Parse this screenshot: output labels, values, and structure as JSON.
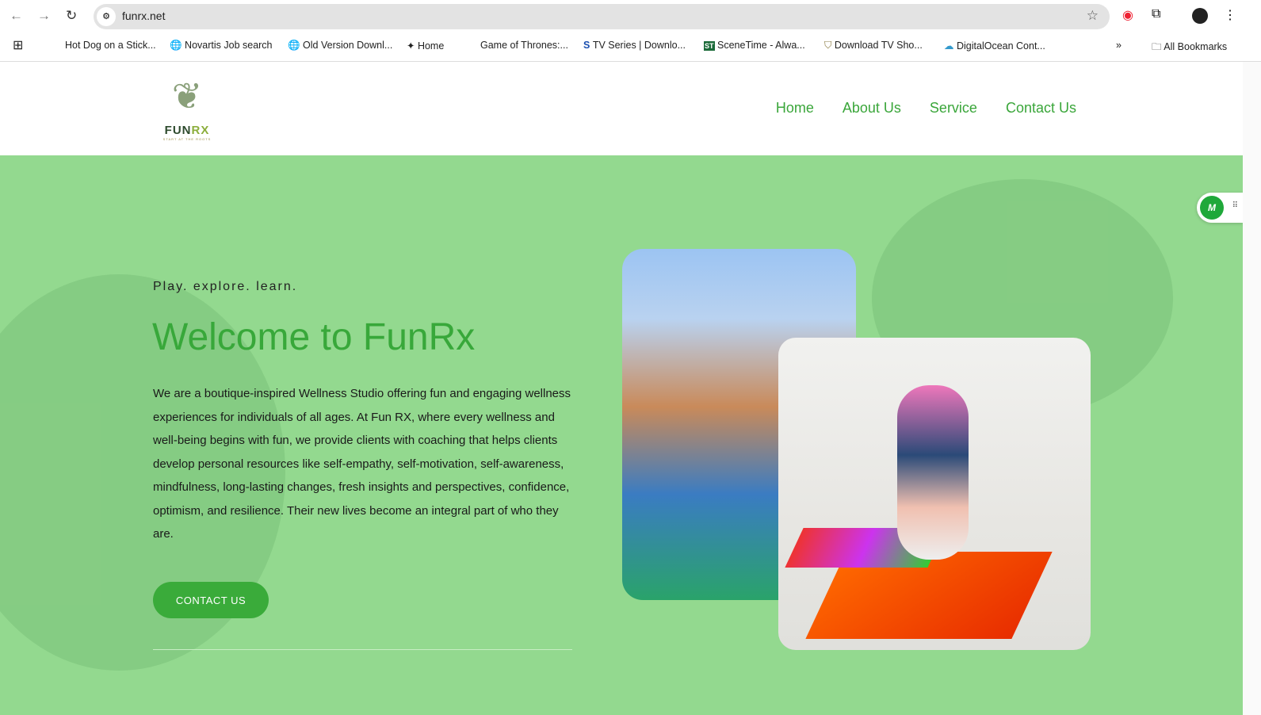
{
  "browser": {
    "url": "funrx.net",
    "bookmarks": [
      {
        "label": "Hot Dog on a Stick...",
        "icon": "none"
      },
      {
        "label": "Novartis Job search",
        "icon": "globe-icon"
      },
      {
        "label": "Old Version Downl...",
        "icon": "globe-icon"
      },
      {
        "label": "Home",
        "icon": "site-icon"
      },
      {
        "label": "Game of Thrones:...",
        "icon": "none"
      },
      {
        "label": "TV Series | Downlo...",
        "icon": "s-icon"
      },
      {
        "label": "SceneTime - Alwa...",
        "icon": "st-icon"
      },
      {
        "label": "Download TV Sho...",
        "icon": "shield-icon"
      },
      {
        "label": "DigitalOcean Cont...",
        "icon": "cloud-icon"
      }
    ],
    "all_bookmarks": "All Bookmarks"
  },
  "site": {
    "logo": {
      "name_a": "FUN",
      "name_b": "RX",
      "tagline": "START AT THE ROOTS"
    },
    "nav": [
      "Home",
      "About Us",
      "Service",
      "Contact Us"
    ],
    "hero": {
      "kicker": "Play. explore. learn.",
      "title": "Welcome to FunRx",
      "paragraph": "We are a boutique-inspired Wellness Studio offering fun and engaging wellness experiences for individuals of all ages. At Fun RX, where every wellness and well-being begins with fun, we provide clients with coaching that helps clients develop personal resources like self-empathy, self-motivation, self-awareness, mindfulness, long-lasting changes, fresh insights and perspectives, confidence, optimism, and resilience. Their new lives become an integral part of who they are.",
      "cta": "CONTACT US"
    },
    "widget": "M"
  },
  "colors": {
    "accent": "#3aab3a",
    "hero_bg": "#93d98f"
  }
}
